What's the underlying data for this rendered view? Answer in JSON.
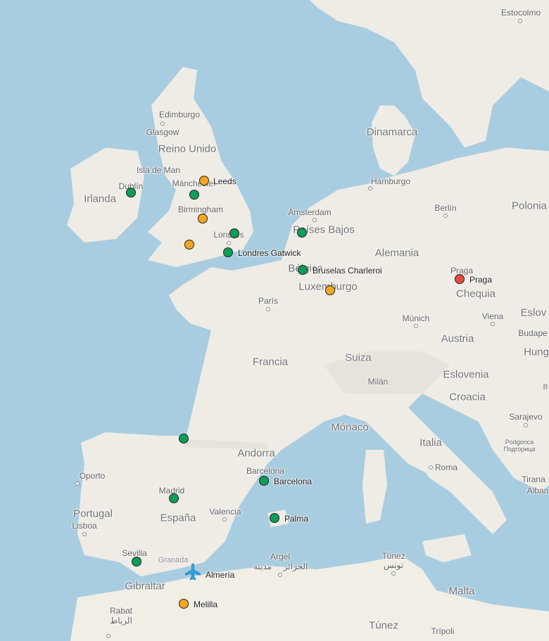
{
  "map": {
    "country_labels": [
      {
        "text": "Reino Unido"
      },
      {
        "text": "Irlanda"
      },
      {
        "text": "Dinamarca"
      },
      {
        "text": "Países Bajos"
      },
      {
        "text": "Alemania"
      },
      {
        "text": "Bélgica"
      },
      {
        "text": "Luxemburgo"
      },
      {
        "text": "Polonia"
      },
      {
        "text": "Chequia"
      },
      {
        "text": "Francia"
      },
      {
        "text": "Suiza"
      },
      {
        "text": "Austria"
      },
      {
        "text": "Eslovenia"
      },
      {
        "text": "Croacia"
      },
      {
        "text": "Mónaco"
      },
      {
        "text": "Andorra"
      },
      {
        "text": "Italia"
      },
      {
        "text": "España"
      },
      {
        "text": "Portugal"
      },
      {
        "text": "Gibraltar"
      },
      {
        "text": "Malta"
      },
      {
        "text": "Túnez"
      },
      {
        "text": "Eslov"
      },
      {
        "text": "Hung"
      }
    ],
    "city_labels": [
      {
        "text": "Estocolmo"
      },
      {
        "text": "Edimburgo"
      },
      {
        "text": "Glasgow"
      },
      {
        "text": "Isla de Man"
      },
      {
        "text": "Dublín"
      },
      {
        "text": "Mánchester"
      },
      {
        "text": "Birmingham"
      },
      {
        "text": "Londres"
      },
      {
        "text": "Ámsterdam"
      },
      {
        "text": "Hamburgo"
      },
      {
        "text": "Berlín"
      },
      {
        "text": "Praga"
      },
      {
        "text": "París"
      },
      {
        "text": "Múnich"
      },
      {
        "text": "Viena"
      },
      {
        "text": "Budape"
      },
      {
        "text": "Milán"
      },
      {
        "text": "Sarajevo"
      },
      {
        "text": "Podgorica"
      },
      {
        "text": "Подгорица"
      },
      {
        "text": "Roma"
      },
      {
        "text": "Tirana"
      },
      {
        "text": "Alban"
      },
      {
        "text": "Oporto"
      },
      {
        "text": "Madrid"
      },
      {
        "text": "Barcelona"
      },
      {
        "text": "Valencia"
      },
      {
        "text": "Lisboa"
      },
      {
        "text": "Sevilla"
      },
      {
        "text": "Granada"
      },
      {
        "text": "Argel"
      },
      {
        "text": "الجزائر"
      },
      {
        "text": "مدينة"
      },
      {
        "text": "Túnez"
      },
      {
        "text": "تونس"
      },
      {
        "text": "Rabat"
      },
      {
        "text": "الرباط"
      },
      {
        "text": "Trípoli"
      },
      {
        "text": "B"
      }
    ],
    "markers": [
      {
        "label": "",
        "status": "green"
      },
      {
        "label": "",
        "status": "green"
      },
      {
        "label": "Leeds",
        "status": "orange"
      },
      {
        "label": "",
        "status": "orange"
      },
      {
        "label": "",
        "status": "orange"
      },
      {
        "label": "",
        "status": "green"
      },
      {
        "label": "Londres Gatwick",
        "status": "green"
      },
      {
        "label": "",
        "status": "green"
      },
      {
        "label": "Bruselas Charleroi",
        "status": "green"
      },
      {
        "label": "",
        "status": "orange"
      },
      {
        "label": "Praga",
        "status": "red"
      },
      {
        "label": "",
        "status": "green"
      },
      {
        "label": "Barcelona",
        "status": "green"
      },
      {
        "label": "",
        "status": "green"
      },
      {
        "label": "Palma",
        "status": "green"
      },
      {
        "label": "",
        "status": "green"
      },
      {
        "label": "Melilla",
        "status": "orange"
      }
    ],
    "origin": {
      "label": "Almería",
      "icon": "airplane-icon"
    },
    "colors": {
      "green": "#0f9d58",
      "orange": "#f5a623",
      "red": "#e64b3b",
      "plane": "#29a8e0",
      "water": "#a9cde0",
      "land": "#f2efe9"
    }
  }
}
